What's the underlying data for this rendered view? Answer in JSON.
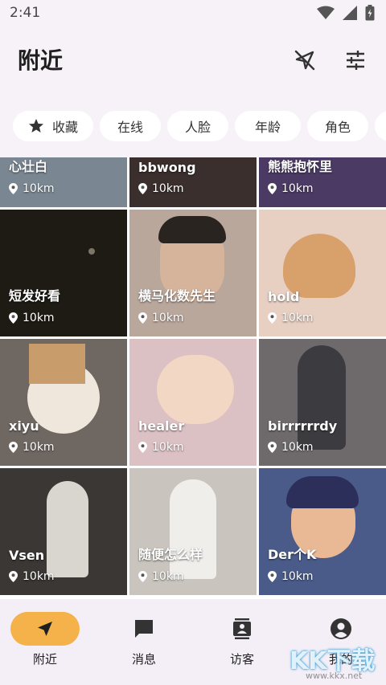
{
  "status_bar": {
    "time": "2:41"
  },
  "header": {
    "title": "附近"
  },
  "filters": [
    "收藏",
    "在线",
    "人脸",
    "年龄",
    "角色"
  ],
  "grid": {
    "tiles": [
      {
        "name": "心壮白",
        "distance": "10km",
        "bg": "#7a8792"
      },
      {
        "name": "bbwong",
        "distance": "10km",
        "bg": "#3a2f2c"
      },
      {
        "name": "熊熊抱怀里",
        "distance": "10km",
        "bg": "#4b3a64"
      },
      {
        "name": "短发好看",
        "distance": "10km",
        "bg": "#1e1a14"
      },
      {
        "name": "横马化数先生",
        "distance": "10km",
        "bg": "#b9a79c"
      },
      {
        "name": "hold",
        "distance": "10km",
        "bg": "#e7cfc2"
      },
      {
        "name": "xiyu",
        "distance": "10km",
        "bg": "#6f6762"
      },
      {
        "name": "healer",
        "distance": "10km",
        "bg": "#dcc1c4"
      },
      {
        "name": "birrrrrrdy",
        "distance": "10km",
        "bg": "#6e6a6c"
      },
      {
        "name": "Vsen",
        "distance": "10km",
        "bg": "#3a3734"
      },
      {
        "name": "随便怎么样",
        "distance": "10km",
        "bg": "#c9c4bd"
      },
      {
        "name": "Der个K",
        "distance": "10km",
        "bg": "#4a5b8a"
      }
    ]
  },
  "bottom_nav": {
    "items": [
      {
        "label": "附近",
        "icon": "navigation-arrow-icon",
        "active": true
      },
      {
        "label": "消息",
        "icon": "message-icon",
        "active": false
      },
      {
        "label": "访客",
        "icon": "visitor-card-icon",
        "active": false
      },
      {
        "label": "我的",
        "icon": "profile-icon",
        "active": false
      }
    ],
    "active_color": "#f5b24a"
  },
  "watermark": {
    "text": "KK下载",
    "url": "www.kkx.net"
  }
}
